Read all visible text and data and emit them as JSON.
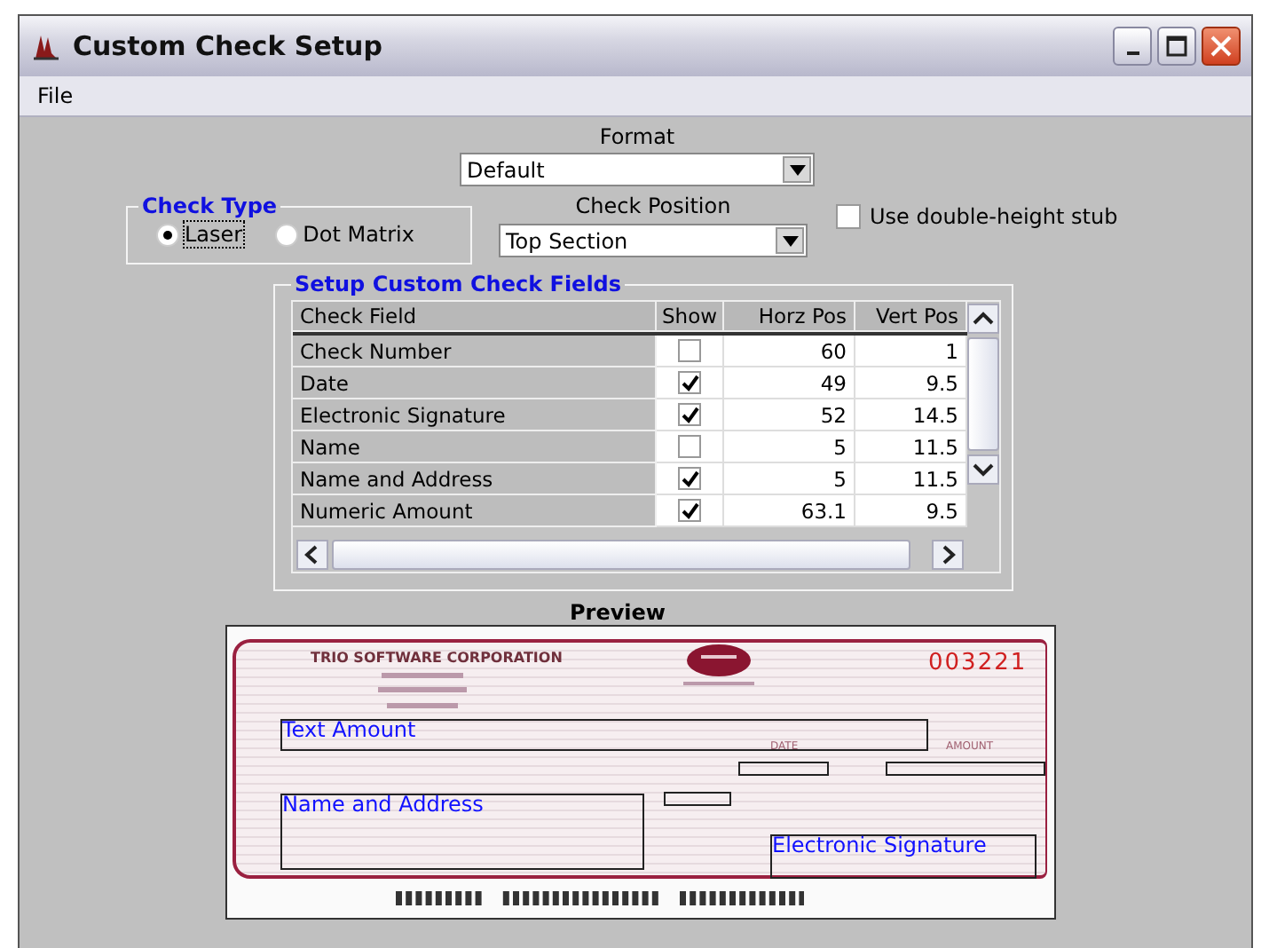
{
  "window": {
    "title": "Custom Check Setup"
  },
  "menu": [
    "File"
  ],
  "format": {
    "label": "Format",
    "value": "Default"
  },
  "check_type": {
    "title": "Check Type",
    "options": [
      {
        "label": "Laser",
        "selected": true
      },
      {
        "label": "Dot Matrix",
        "selected": false
      }
    ]
  },
  "check_position": {
    "label": "Check Position",
    "value": "Top Section"
  },
  "double_height_stub": {
    "label": "Use double-height stub",
    "checked": false
  },
  "fields_table": {
    "title": "Setup Custom Check Fields",
    "columns": [
      "Check Field",
      "Show",
      "Horz Pos",
      "Vert Pos"
    ],
    "rows": [
      {
        "field": "Check Number",
        "show": false,
        "horz": "60",
        "vert": "1"
      },
      {
        "field": "Date",
        "show": true,
        "horz": "49",
        "vert": "9.5"
      },
      {
        "field": "Electronic Signature",
        "show": true,
        "horz": "52",
        "vert": "14.5"
      },
      {
        "field": "Name",
        "show": false,
        "horz": "5",
        "vert": "11.5"
      },
      {
        "field": "Name and Address",
        "show": true,
        "horz": "5",
        "vert": "11.5"
      },
      {
        "field": "Numeric Amount",
        "show": true,
        "horz": "63.1",
        "vert": "9.5"
      }
    ]
  },
  "preview": {
    "title": "Preview",
    "company": "TRIO SOFTWARE CORPORATION",
    "check_number": "003221",
    "date_label": "DATE",
    "amount_label": "AMOUNT",
    "fields": [
      {
        "label": "Text Amount"
      },
      {
        "label": "Name and Address"
      },
      {
        "label": "Electronic Signature"
      }
    ]
  }
}
